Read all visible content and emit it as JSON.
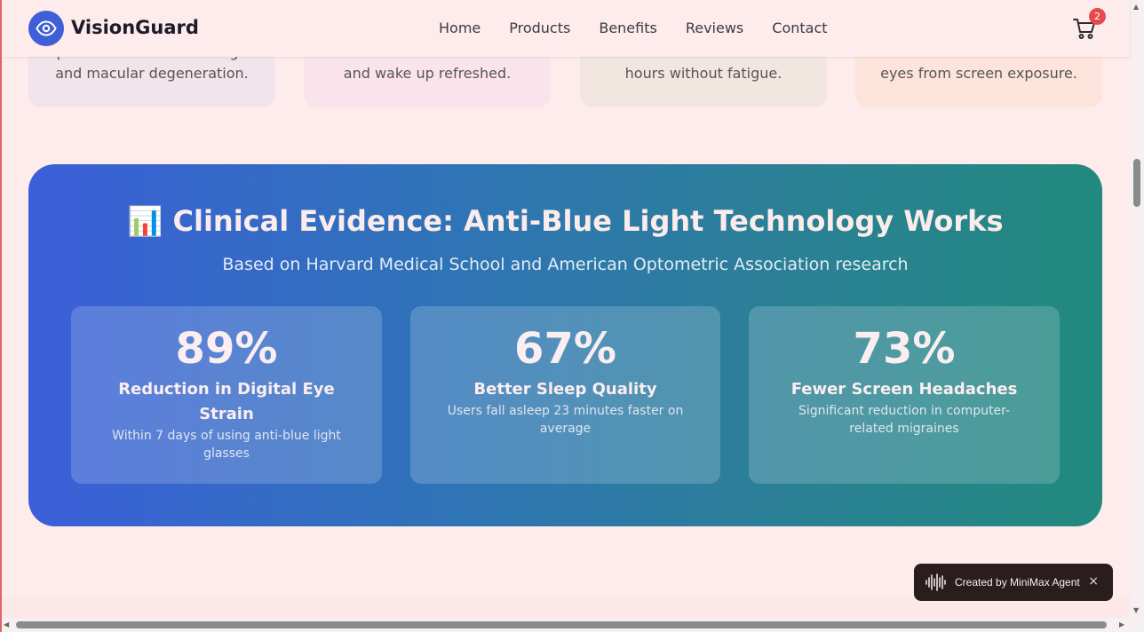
{
  "brand": {
    "name": "VisionGuard",
    "logo_icon": "eye-icon",
    "accent": "#3f5fd8"
  },
  "nav": {
    "items": [
      {
        "label": "Home"
      },
      {
        "label": "Products"
      },
      {
        "label": "Benefits"
      },
      {
        "label": "Reviews"
      },
      {
        "label": "Contact"
      }
    ]
  },
  "cart": {
    "icon": "cart-icon",
    "count": "2"
  },
  "top_cards": [
    {
      "text": "permanent retinal damage and macular degeneration.",
      "bg": "#f1e4ea"
    },
    {
      "text": "and wake up refreshed.",
      "bg": "#fbe3ec"
    },
    {
      "text": "hours without fatigue.",
      "bg": "#f2e6e1"
    },
    {
      "text": "eyes from screen exposure.",
      "bg": "#fde4da"
    }
  ],
  "evidence": {
    "title_icon": "📊",
    "title": "Clinical Evidence: Anti-Blue Light Technology Works",
    "subtitle": "Based on Harvard Medical School and American Optometric Association research",
    "stats": [
      {
        "value": "89%",
        "label": "Reduction in Digital Eye Strain",
        "desc": "Within 7 days of using anti-blue light glasses"
      },
      {
        "value": "67%",
        "label": "Better Sleep Quality",
        "desc": "Users fall asleep 23 minutes faster on average"
      },
      {
        "value": "73%",
        "label": "Fewer Screen Headaches",
        "desc": "Significant reduction in computer-related migraines"
      }
    ]
  },
  "toast": {
    "text": "Created by MiniMax Agent",
    "close": "×",
    "icon": "waveform-icon"
  }
}
